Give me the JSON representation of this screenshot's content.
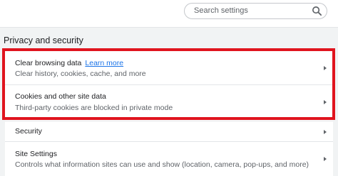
{
  "search": {
    "placeholder": "Search settings",
    "icon": "search-icon"
  },
  "section": {
    "title": "Privacy and security"
  },
  "rows": [
    {
      "title": "Clear browsing data",
      "link": "Learn more",
      "subtitle": "Clear history, cookies, cache, and more"
    },
    {
      "title": "Cookies and other site data",
      "subtitle": "Third-party cookies are blocked in private mode"
    },
    {
      "title": "Security"
    },
    {
      "title": "Site Settings",
      "subtitle": "Controls what information sites can use and show (location, camera, pop-ups, and more)"
    }
  ],
  "colors": {
    "highlight": "#e0141e",
    "link": "#1a73e8",
    "background": "#f1f3f4"
  }
}
